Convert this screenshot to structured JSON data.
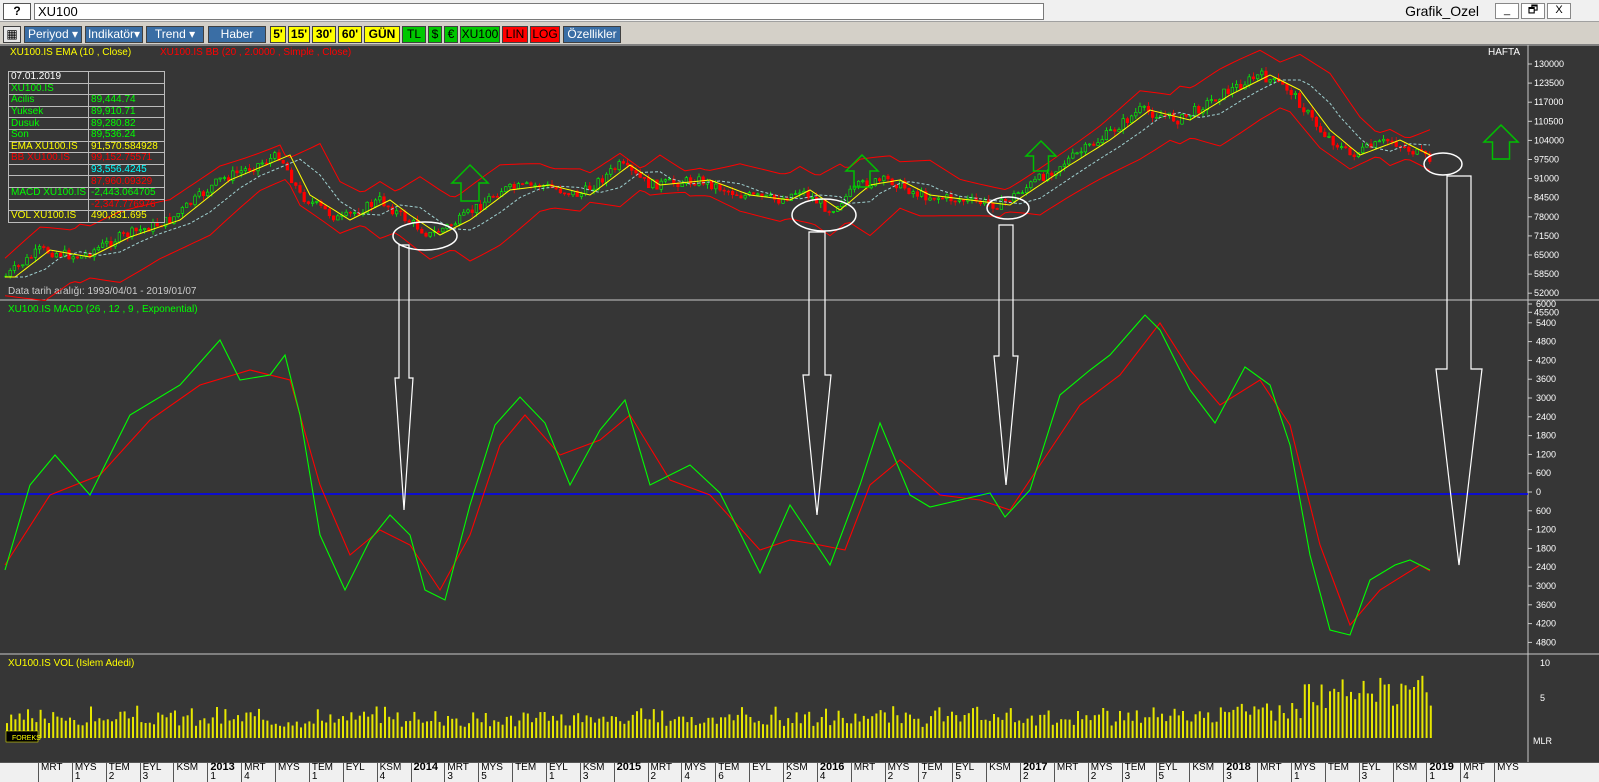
{
  "window": {
    "sys_button": "?",
    "symbol": "XU100",
    "title": "Grafik_Ozel",
    "controls": [
      "_",
      "🗗",
      "X"
    ]
  },
  "toolbar": {
    "periyod": "Periyod",
    "indikator": "Indikatör",
    "trend": "Trend",
    "haber": "Haber",
    "p5": "5'",
    "p15": "15'",
    "p30": "30'",
    "p60": "60'",
    "gun": "GÜN",
    "tl": "TL",
    "usd": "$",
    "eur": "€",
    "xu100": "XU100",
    "lin": "LIN",
    "log": "LOG",
    "ozellikler": "Özellikler"
  },
  "price_panel": {
    "legend_ema": "XU100.IS EMA (10 , Close)",
    "legend_bb": "XU100.IS BB (20 , 2.0000 , Simple , Close)",
    "period": "HAFTA",
    "date_range": "Data tarih aralığı: 1993/04/01 - 2019/01/07",
    "y_ticks": [
      "130000",
      "123500",
      "117000",
      "110500",
      "104000",
      "97500",
      "91000",
      "84500",
      "78000",
      "71500",
      "65000",
      "58500",
      "52000",
      "45500"
    ]
  },
  "info_table": [
    {
      "label": "07.01.2019",
      "value": "",
      "label_color": "w",
      "value_color": "w"
    },
    {
      "label": "XU100.IS",
      "value": "",
      "label_color": "g",
      "value_color": "g"
    },
    {
      "label": "Acilis",
      "value": "89,444.74",
      "label_color": "g",
      "value_color": "g"
    },
    {
      "label": "Yuksek",
      "value": "89,910.71",
      "label_color": "g",
      "value_color": "g"
    },
    {
      "label": "Dusuk",
      "value": "89,280.82",
      "label_color": "g",
      "value_color": "g"
    },
    {
      "label": "Son",
      "value": "89,536.24",
      "label_color": "g",
      "value_color": "g"
    },
    {
      "label": "EMA XU100.IS",
      "value": "91,570.584928",
      "label_color": "y",
      "value_color": "y"
    },
    {
      "label": "BB XU100.IS",
      "value": "99,152.75571",
      "label_color": "r",
      "value_color": "r"
    },
    {
      "label": "",
      "value": "93,556.4245",
      "label_color": "c",
      "value_color": "c"
    },
    {
      "label": "",
      "value": "87,960.09329",
      "label_color": "r",
      "value_color": "r"
    },
    {
      "label": "MACD XU100.IS",
      "value": "-2,443.064705",
      "label_color": "g",
      "value_color": "g"
    },
    {
      "label": "",
      "value": "-2,347.776976",
      "label_color": "r",
      "value_color": "r"
    },
    {
      "label": "VOL XU100.IS",
      "value": "490,831.695",
      "label_color": "y",
      "value_color": "y"
    }
  ],
  "macd_panel": {
    "legend": "XU100.IS MACD (26 , 12 , 9 , Exponential)",
    "y_ticks": [
      "6000",
      "5400",
      "4800",
      "4200",
      "3600",
      "3000",
      "2400",
      "1800",
      "1200",
      "600",
      "0",
      "600",
      "1200",
      "1800",
      "2400",
      "3000",
      "3600",
      "4200",
      "4800"
    ]
  },
  "vol_panel": {
    "legend": "XU100.IS VOL (Islem Adedi)",
    "y_ticks": [
      "10",
      "5"
    ],
    "unit": "MLR",
    "logo": "FOREKS"
  },
  "timebar": [
    {
      "top": "MRT",
      "bot": ""
    },
    {
      "top": "MYS",
      "bot": "1"
    },
    {
      "top": "TEM",
      "bot": "2"
    },
    {
      "top": "EYL",
      "bot": "3"
    },
    {
      "top": "KSM",
      "bot": ""
    },
    {
      "top": "2013",
      "bot": "1",
      "year": true
    },
    {
      "top": "MRT",
      "bot": "4"
    },
    {
      "top": "MYS",
      "bot": ""
    },
    {
      "top": "TEM",
      "bot": "1"
    },
    {
      "top": "EYL",
      "bot": ""
    },
    {
      "top": "KSM",
      "bot": "4"
    },
    {
      "top": "2014",
      "bot": "",
      "year": true
    },
    {
      "top": "MRT",
      "bot": "3"
    },
    {
      "top": "MYS",
      "bot": "5"
    },
    {
      "top": "TEM",
      "bot": ""
    },
    {
      "top": "EYL",
      "bot": "1"
    },
    {
      "top": "KSM",
      "bot": "3"
    },
    {
      "top": "2015",
      "bot": "",
      "year": true
    },
    {
      "top": "MRT",
      "bot": "2"
    },
    {
      "top": "MYS",
      "bot": "4"
    },
    {
      "top": "TEM",
      "bot": "6"
    },
    {
      "top": "EYL",
      "bot": ""
    },
    {
      "top": "KSM",
      "bot": "2"
    },
    {
      "top": "2016",
      "bot": "4",
      "year": true
    },
    {
      "top": "MRT",
      "bot": ""
    },
    {
      "top": "MYS",
      "bot": "2"
    },
    {
      "top": "TEM",
      "bot": "7"
    },
    {
      "top": "EYL",
      "bot": "5"
    },
    {
      "top": "KSM",
      "bot": ""
    },
    {
      "top": "2017",
      "bot": "2",
      "year": true
    },
    {
      "top": "MRT",
      "bot": ""
    },
    {
      "top": "MYS",
      "bot": "2"
    },
    {
      "top": "TEM",
      "bot": "3"
    },
    {
      "top": "EYL",
      "bot": "5"
    },
    {
      "top": "KSM",
      "bot": ""
    },
    {
      "top": "2018",
      "bot": "3",
      "year": true
    },
    {
      "top": "MRT",
      "bot": ""
    },
    {
      "top": "MYS",
      "bot": "1"
    },
    {
      "top": "TEM",
      "bot": ""
    },
    {
      "top": "EYL",
      "bot": "3"
    },
    {
      "top": "KSM",
      "bot": ""
    },
    {
      "top": "2019",
      "bot": "1",
      "year": true
    },
    {
      "top": "MRT",
      "bot": "4"
    },
    {
      "top": "MYS",
      "bot": ""
    }
  ],
  "colors": {
    "background": "#363636",
    "green": "#00ff00",
    "red": "#ff0000",
    "yellow": "#ffff00",
    "zero_line": "#0000ff",
    "annotation": "#ffffff",
    "arrow_up": "#00c000"
  }
}
